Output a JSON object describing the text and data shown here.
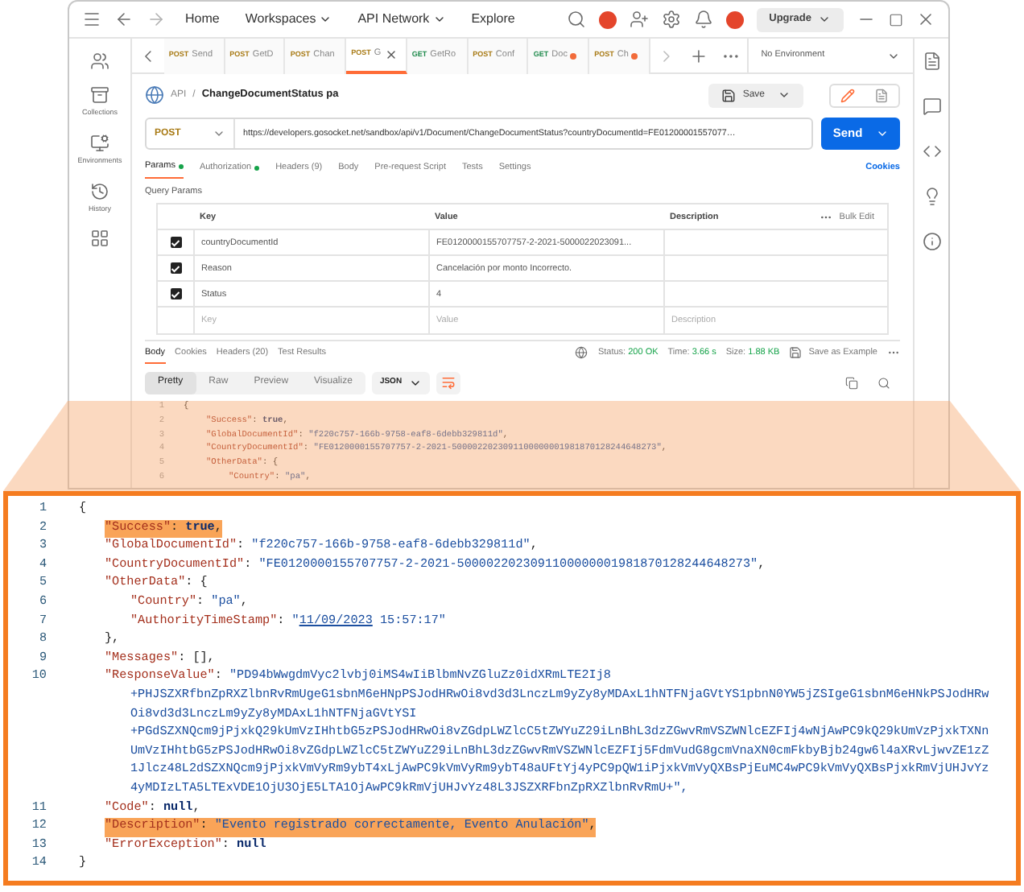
{
  "topbar": {
    "nav": [
      {
        "label": "Home",
        "dropdown": false
      },
      {
        "label": "Workspaces",
        "dropdown": true
      },
      {
        "label": "API Network",
        "dropdown": true
      },
      {
        "label": "Explore",
        "dropdown": false
      }
    ],
    "upgrade": "Upgrade"
  },
  "sidebar": {
    "items": [
      {
        "label": "Collections"
      },
      {
        "label": "Environments"
      },
      {
        "label": "History"
      }
    ]
  },
  "request_tabs": [
    {
      "method": "POST",
      "label": "Send",
      "selected": false,
      "dirty": false
    },
    {
      "method": "POST",
      "label": "GetD",
      "selected": false,
      "dirty": false
    },
    {
      "method": "POST",
      "label": "Chan",
      "selected": false,
      "dirty": false
    },
    {
      "method": "POST",
      "label": "G",
      "selected": true,
      "dirty": false
    },
    {
      "method": "GET",
      "label": "GetRo",
      "selected": false,
      "dirty": false
    },
    {
      "method": "POST",
      "label": "Conf",
      "selected": false,
      "dirty": false
    },
    {
      "method": "GET",
      "label": "Doc",
      "selected": false,
      "dirty": true
    },
    {
      "method": "POST",
      "label": "Ch",
      "selected": false,
      "dirty": true
    }
  ],
  "environment": "No Environment",
  "breadcrumb": {
    "parent": "API",
    "separator": "/",
    "name": "ChangeDocumentStatus pa"
  },
  "save": "Save",
  "request": {
    "method": "POST",
    "url": "https://developers.gosocket.net/sandbox/api/v1/Document/ChangeDocumentStatus?countryDocumentId=FE01200001557077…",
    "send": "Send"
  },
  "request_sections": [
    {
      "label": "Params",
      "selected": true,
      "indicator": true
    },
    {
      "label": "Authorization",
      "selected": false,
      "indicator": true
    },
    {
      "label": "Headers (9)",
      "selected": false,
      "indicator": false
    },
    {
      "label": "Body",
      "selected": false,
      "indicator": false
    },
    {
      "label": "Pre-request Script",
      "selected": false,
      "indicator": false
    },
    {
      "label": "Tests",
      "selected": false,
      "indicator": false
    },
    {
      "label": "Settings",
      "selected": false,
      "indicator": false
    }
  ],
  "cookies": "Cookies",
  "query_params": {
    "title": "Query Params",
    "columns": [
      "Key",
      "Value",
      "Description"
    ],
    "bulk_edit": "Bulk Edit",
    "rows": [
      {
        "checked": true,
        "key": "countryDocumentId",
        "value": "FE0120000155707757-2-2021-5000022023091..."
      },
      {
        "checked": true,
        "key": "Reason",
        "value": "Cancelación por monto Incorrecto."
      },
      {
        "checked": true,
        "key": "Status",
        "value": "4"
      }
    ],
    "new_row": [
      {
        "placeholder": "Key"
      },
      {
        "placeholder": "Value"
      },
      {
        "placeholder": "Description"
      }
    ]
  },
  "response_sections": [
    {
      "label": "Body",
      "selected": true
    },
    {
      "label": "Cookies",
      "selected": false
    },
    {
      "label": "Headers (20)",
      "selected": false
    },
    {
      "label": "Test Results",
      "selected": false
    }
  ],
  "response_status": {
    "status_label": "Status:",
    "status": "200 OK",
    "time_label": "Time:",
    "time": "3.66 s",
    "size_label": "Size:",
    "size": "1.88 KB",
    "save_example": "Save as Example"
  },
  "view_modes": [
    {
      "label": "Pretty",
      "selected": true
    },
    {
      "label": "Raw",
      "selected": false
    },
    {
      "label": "Preview",
      "selected": false
    },
    {
      "label": "Visualize",
      "selected": false
    }
  ],
  "format": "JSON",
  "editor_lines": [
    {
      "num": "1",
      "tokens": [
        {
          "kind": "punct",
          "text": "{"
        }
      ],
      "children": [
        {
          "num": "2",
          "tokens": [
            {
              "kind": "key",
              "text": "\"Success\""
            },
            {
              "kind": "punct",
              "text": ": "
            },
            {
              "kind": "lit",
              "text": "true"
            },
            {
              "kind": "punct",
              "text": ","
            }
          ]
        },
        {
          "num": "3",
          "tokens": [
            {
              "kind": "key",
              "text": "\"GlobalDocumentId\""
            },
            {
              "kind": "punct",
              "text": ": "
            },
            {
              "kind": "str",
              "text": "\"f220c757-166b-9758-eaf8-6debb329811d\""
            },
            {
              "kind": "punct",
              "text": ","
            }
          ]
        },
        {
          "num": "4",
          "tokens": [
            {
              "kind": "key",
              "text": "\"CountryDocumentId\""
            },
            {
              "kind": "punct",
              "text": ": "
            },
            {
              "kind": "str",
              "text": "\"FE0120000155707757-2-2021-5000022023091100000001981870128244648273\""
            },
            {
              "kind": "punct",
              "text": ","
            }
          ]
        },
        {
          "num": "5",
          "tokens": [
            {
              "kind": "key",
              "text": "\"OtherData\""
            },
            {
              "kind": "punct",
              "text": ": {"
            }
          ],
          "children": [
            {
              "num": "6",
              "tokens": [
                {
                  "kind": "key",
                  "text": "\"Country\""
                },
                {
                  "kind": "punct",
                  "text": ": "
                },
                {
                  "kind": "str",
                  "text": "\"pa\""
                },
                {
                  "kind": "punct",
                  "text": ","
                }
              ]
            }
          ]
        }
      ]
    }
  ],
  "callout_lines": [
    {
      "num": "1",
      "highlighted": false,
      "tokens": [
        {
          "kind": "punct",
          "text": "{"
        }
      ],
      "children": [
        {
          "num": "2",
          "highlighted": true,
          "tokens": [
            {
              "kind": "key",
              "text": "\"Success\""
            },
            {
              "kind": "punct",
              "text": ": "
            },
            {
              "kind": "lit",
              "text": "true"
            },
            {
              "kind": "punct",
              "text": ","
            }
          ]
        },
        {
          "num": "3",
          "highlighted": false,
          "tokens": [
            {
              "kind": "key",
              "text": "\"GlobalDocumentId\""
            },
            {
              "kind": "punct",
              "text": ": "
            },
            {
              "kind": "str",
              "text": "\"f220c757-166b-9758-eaf8-6debb329811d\""
            },
            {
              "kind": "punct",
              "text": ","
            }
          ]
        },
        {
          "num": "4",
          "highlighted": false,
          "tokens": [
            {
              "kind": "key",
              "text": "\"CountryDocumentId\""
            },
            {
              "kind": "punct",
              "text": ": "
            },
            {
              "kind": "str",
              "text": "\"FE0120000155707757-2-2021-5000022023091100000001981870128244648273\""
            },
            {
              "kind": "punct",
              "text": ","
            }
          ]
        },
        {
          "num": "5",
          "highlighted": false,
          "tokens": [
            {
              "kind": "key",
              "text": "\"OtherData\""
            },
            {
              "kind": "punct",
              "text": ": {"
            }
          ],
          "children": [
            {
              "num": "6",
              "highlighted": false,
              "tokens": [
                {
                  "kind": "key",
                  "text": "\"Country\""
                },
                {
                  "kind": "punct",
                  "text": ": "
                },
                {
                  "kind": "str",
                  "text": "\"pa\""
                },
                {
                  "kind": "punct",
                  "text": ","
                }
              ]
            },
            {
              "num": "7",
              "highlighted": false,
              "tokens": [
                {
                  "kind": "key",
                  "text": "\"AuthorityTimeStamp\""
                },
                {
                  "kind": "punct",
                  "text": ": "
                },
                {
                  "kind": "str",
                  "text": "\""
                },
                {
                  "kind": "link",
                  "text": "11/09/2023"
                },
                {
                  "kind": "str",
                  "text": " 15:57:17\""
                }
              ]
            }
          ]
        },
        {
          "num": "8",
          "highlighted": false,
          "tokens": [
            {
              "kind": "punct",
              "text": "},"
            }
          ]
        },
        {
          "num": "9",
          "highlighted": false,
          "tokens": [
            {
              "kind": "key",
              "text": "\"Messages\""
            },
            {
              "kind": "punct",
              "text": ": [],"
            }
          ]
        },
        {
          "num": "10",
          "highlighted": false,
          "tokens": [
            {
              "kind": "key",
              "text": "\"ResponseValue\""
            },
            {
              "kind": "punct",
              "text": ": "
            },
            {
              "kind": "str",
              "text": "\"PD94bWwgdmVyc2lvbj0iMS4wIiBlbmNvZGluZz0idXRmLTE2Ij8"
            }
          ],
          "continuation": [
            "+PHJSZXRfbnZpRXZlbnRvRmUgeG1sbnM6eHNpPSJodHRwOi8vd3d3LnczLm9yZy8yMDAxL1hNTFNjaGVtYS1pbnN0YW5jZSIgeG1sbnM6eHNkPSJodHRw",
            "Oi8vd3d3LnczLm9yZy8yMDAxL1hNTFNjaGVtYSI",
            "+PGdSZXNQcm9jPjxkQ29kUmVzIHhtbG5zPSJodHRwOi8vZGdpLWZlcC5tZWYuZ29iLnBhL3dzZGwvRmVSZWNlcEZFIj4wNjAwPC9kQ29kUmVzPjxkTXNn",
            "UmVzIHhtbG5zPSJodHRwOi8vZGdpLWZlcC5tZWYuZ29iLnBhL3dzZGwvRmVSZWNlcEZFIj5FdmVudG8gcmVnaXN0cmFkbyBjb24gw6l4aXRvLjwvZE1zZ",
            "1Jlcz48L2dSZXNQcm9jPjxkVmVyRm9ybT4xLjAwPC9kVmVyRm9ybT48aUFtYj4yPC9pQW1iPjxkVmVyQXBsPjEuMC4wPC9kVmVyQXBsPjxkRmVjUHJvYz",
            "4yMDIzLTA5LTExVDE1OjU3OjE5LTA1OjAwPC9kRmVjUHJvYz48L3JSZXRFbnZpRXZlbnRvRmU+\","
          ]
        },
        {
          "num": "11",
          "highlighted": false,
          "tokens": [
            {
              "kind": "key",
              "text": "\"Code\""
            },
            {
              "kind": "punct",
              "text": ": "
            },
            {
              "kind": "lit",
              "text": "null"
            },
            {
              "kind": "punct",
              "text": ","
            }
          ]
        },
        {
          "num": "12",
          "highlighted": true,
          "tokens": [
            {
              "kind": "key",
              "text": "\"Description\""
            },
            {
              "kind": "punct",
              "text": ": "
            },
            {
              "kind": "str",
              "text": "\"Evento registrado correctamente, Evento Anulación\""
            },
            {
              "kind": "punct",
              "text": ","
            }
          ]
        },
        {
          "num": "13",
          "highlighted": false,
          "tokens": [
            {
              "kind": "key",
              "text": "\"ErrorException\""
            },
            {
              "kind": "punct",
              "text": ": "
            },
            {
              "kind": "lit",
              "text": "null"
            }
          ]
        }
      ]
    },
    {
      "num": "14",
      "highlighted": false,
      "tokens": [
        {
          "kind": "punct",
          "text": "}"
        }
      ]
    }
  ]
}
